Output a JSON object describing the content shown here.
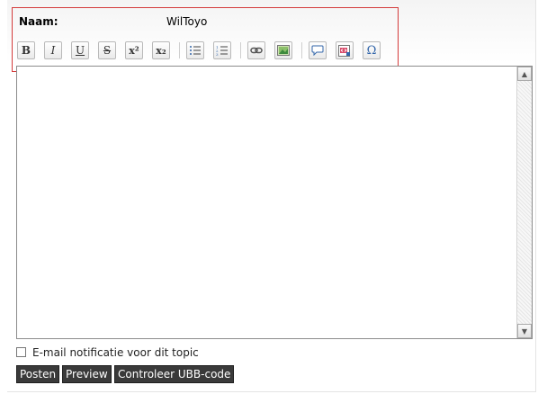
{
  "form": {
    "name_label": "Naam:",
    "name_value": "WilToyo"
  },
  "toolbar": {
    "bold": "B",
    "italic": "I",
    "underline": "U",
    "strike": "S",
    "superscript": "x²",
    "subscript": "x₂",
    "omega": "Ω",
    "icons": [
      "bold-icon",
      "italic-icon",
      "underline-icon",
      "strikethrough-icon",
      "superscript-icon",
      "subscript-icon",
      "unordered-list-icon",
      "ordered-list-icon",
      "link-icon",
      "image-icon",
      "quote-icon",
      "code-icon",
      "special-char-icon"
    ]
  },
  "editor": {
    "content": ""
  },
  "notification": {
    "label": "E-mail notificatie voor dit topic",
    "checked": false
  },
  "buttons": {
    "post": "Posten",
    "preview": "Preview",
    "check": "Controleer UBB-code"
  },
  "colors": {
    "highlight_border": "#d43b3b",
    "button_bg": "#3a3a3a"
  }
}
